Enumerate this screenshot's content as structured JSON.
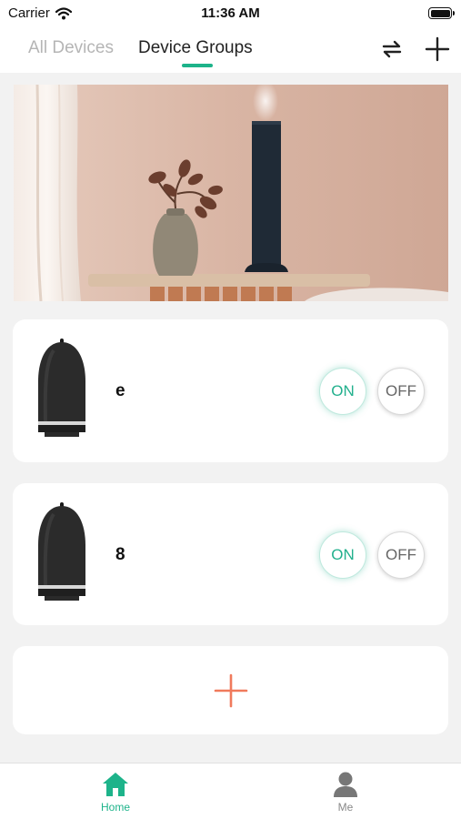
{
  "status_bar": {
    "carrier": "Carrier",
    "time": "11:36 AM",
    "icons": [
      "wifi-icon",
      "battery-icon"
    ]
  },
  "top_nav": {
    "tabs": [
      {
        "label": "All Devices",
        "active": false
      },
      {
        "label": "Device Groups",
        "active": true
      }
    ],
    "icons": [
      "swap-icon",
      "plus-icon"
    ]
  },
  "devices": [
    {
      "name": "e",
      "on_label": "ON",
      "off_label": "OFF"
    },
    {
      "name": "8",
      "on_label": "ON",
      "off_label": "OFF"
    }
  ],
  "add_card": {
    "icon": "plus-icon"
  },
  "tab_bar": {
    "items": [
      {
        "label": "Home",
        "icon": "home-icon",
        "active": true
      },
      {
        "label": "Me",
        "icon": "person-icon",
        "active": false
      }
    ]
  },
  "colors": {
    "accent": "#1db38a",
    "add_plus": "#f07a5c",
    "background": "#f2f2f2"
  }
}
